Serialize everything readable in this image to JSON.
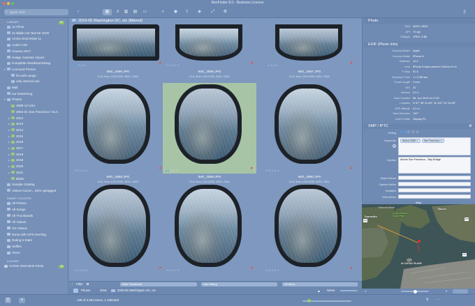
{
  "window": {
    "title": "NeoFinder 8.0 - Business License"
  },
  "toolbar": {
    "search_placeholder": "Quick Find"
  },
  "sidebar": {
    "library_header": "LIBRARY",
    "library_badge": "87",
    "library_items": [
      {
        "label": "12 Filme",
        "icon": "folder",
        "indent": 0,
        "tri": ""
      },
      {
        "label": "21 Bilder mit Text für OCR",
        "icon": "folder",
        "indent": 0,
        "tri": ""
      },
      {
        "label": "Archiv DVD-ROM 11",
        "icon": "folder",
        "indent": 0,
        "tri": ""
      },
      {
        "label": "Audio-CDs",
        "icon": "folder",
        "indent": 0,
        "tri": ""
      },
      {
        "label": "Cinema 2017",
        "icon": "folder",
        "indent": 0,
        "tri": ""
      },
      {
        "label": "Hedge Canister Import",
        "icon": "folder",
        "indent": 0,
        "tri": ""
      },
      {
        "label": "Komplette Musiksammlung",
        "icon": "folder",
        "indent": 0,
        "tri": ""
      },
      {
        "label": "Licensed Photos",
        "icon": "folder",
        "indent": 0,
        "tri": "▾"
      },
      {
        "label": "for web usage",
        "icon": "folder",
        "indent": 1,
        "tri": ""
      },
      {
        "label": "only internal use",
        "icon": "folder",
        "indent": 1,
        "tri": ""
      },
      {
        "label": "Mail",
        "icon": "folder",
        "indent": 0,
        "tri": ""
      },
      {
        "label": "nur bewertung",
        "icon": "folder",
        "indent": 0,
        "tri": ""
      },
      {
        "label": "Photos",
        "icon": "folder",
        "indent": 0,
        "tri": "▾"
      },
      {
        "label": "1998-12 USA",
        "icon": "green",
        "indent": 1,
        "tri": ""
      },
      {
        "label": "2002-01 San Francisco / SLC",
        "icon": "green",
        "indent": 1,
        "tri": ""
      },
      {
        "label": "2012",
        "icon": "green",
        "indent": 1,
        "tri": "▸"
      },
      {
        "label": "2013",
        "icon": "green",
        "indent": 1,
        "tri": "▸"
      },
      {
        "label": "2014",
        "icon": "green",
        "indent": 1,
        "tri": "▸"
      },
      {
        "label": "2015",
        "icon": "green",
        "indent": 1,
        "tri": "▸"
      },
      {
        "label": "2016",
        "icon": "green",
        "indent": 1,
        "tri": "▸"
      },
      {
        "label": "2017",
        "icon": "green",
        "indent": 1,
        "tri": "▸"
      },
      {
        "label": "2018",
        "icon": "green",
        "indent": 1,
        "tri": "▸"
      },
      {
        "label": "2019",
        "icon": "green",
        "indent": 1,
        "tri": "▸"
      },
      {
        "label": "2020",
        "icon": "green",
        "indent": 1,
        "tri": "▸"
      },
      {
        "label": "2021",
        "icon": "green",
        "indent": 1,
        "tri": "▸"
      },
      {
        "label": "Bilder",
        "icon": "green",
        "indent": 1,
        "tri": ""
      },
      {
        "label": "Sample Catalog",
        "icon": "folder",
        "indent": 0,
        "tri": ""
      },
      {
        "label": "Videos Canon...InDV getagged",
        "icon": "folder",
        "indent": 0,
        "tri": ""
      }
    ],
    "smart_header": "SMART FOLDERS",
    "smart_items": [
      "All Photos",
      "All Songs",
      "All Thumbnails",
      "All Videos",
      "HD Videos",
      "Items with GPS GeoTag",
      "Rating 5 Stars",
      "Selfies",
      "Years"
    ],
    "album_header": "ALBUMS",
    "album_item": "Arches 2018 Best Shots",
    "album_badge": "18"
  },
  "breadcrumb": {
    "title": "2019-06 Washington DC, etc  (filtered)"
  },
  "grid": {
    "items": [
      {
        "name": "IMG_2496.JPG",
        "meta": "f/1.8, 3mm, 1/16 ISO20, 4032 × 3024",
        "selected": false,
        "rating": 2,
        "pin": true
      },
      {
        "name": "IMG_2586.JPG",
        "meta": "f/1.8, 3mm, 1/16 ISO20, 4032 × 3024",
        "selected": false,
        "rating": 0,
        "pin": true
      },
      {
        "name": "IMG_2587.JPG",
        "meta": "f/1.8, 3mm, 1/16 ISO20, 4032 × 3024",
        "selected": false,
        "rating": 1,
        "pin": true
      },
      {
        "name": "IMG_2588.JPG",
        "meta": "f/1.8, 3mm, 1/16 ISO20, 4032 × 3024",
        "selected": false,
        "rating": 0,
        "pin": true
      },
      {
        "name": "IMG_2589.JPG",
        "meta": "f/1.8, 3mm, 1/16 ISO20, 4032 × 3024",
        "selected": true,
        "rating": 2,
        "pin": true
      },
      {
        "name": "IMG_2590.JPG",
        "meta": "f/1.8, 3mm, 1/16 ISO20, 4032 × 3024",
        "selected": false,
        "rating": 0,
        "pin": true
      },
      {
        "name": "IMG_2591.JPG",
        "meta": "f/1.8, 3mm, 1/16 ISO20, 4032 × 3024",
        "selected": false,
        "rating": 0,
        "pin": true
      },
      {
        "name": "IMG_2592.JPG",
        "meta": "f/1.8, 3mm, 1/16 ISO20, 4032 × 3024",
        "selected": false,
        "rating": 0,
        "pin": true
      },
      {
        "name": "IMG_2593.JPG",
        "meta": "f/1.8, 3mm, 1/16 ISO20, 4032 × 3024",
        "selected": false,
        "rating": 0,
        "pin": true
      }
    ]
  },
  "filter": {
    "label": "Filter",
    "opt1": "With Thumbnail",
    "opt2": "Has Rating",
    "opt3": "All Items"
  },
  "pathbar": {
    "segment1": "Photos",
    "segment2": "2019",
    "segment3": "2019-06 Washington DC, etc",
    "sort_label": "Name"
  },
  "inspector": {
    "photo_header": "Photo",
    "photo_rows": [
      {
        "k": "Size",
        "v": "4032 x 3024"
      },
      {
        "k": "DPI",
        "v": "72 dpi"
      },
      {
        "k": "Filetype",
        "v": "JPEG, 8 Bit"
      }
    ],
    "exif_header": "EXIF (Photo Info)",
    "exif_rows": [
      {
        "k": "Camera Maker",
        "v": "Apple"
      },
      {
        "k": "Camera Model",
        "v": "iPhone 8"
      },
      {
        "k": "Software",
        "v": "12.2"
      },
      {
        "k": "Lens",
        "v": "iPhone 8 back camera 3.99mm f/1.8"
      },
      {
        "k": "F-Stop",
        "v": "f/1.8"
      },
      {
        "k": "Exposure Time",
        "v": "1 / 1798 sec."
      },
      {
        "k": "Focal Length",
        "v": "3 mm"
      },
      {
        "k": "ISO",
        "v": "20"
      },
      {
        "k": "Version",
        "v": "2.2.1"
      },
      {
        "k": "Date Created",
        "v": "06. Jun 2019 at 17:53"
      },
      {
        "k": "Location",
        "v": "N 37° 48' 41.65\", W 122° 24' 24.00\""
      },
      {
        "k": "GPS Altitude",
        "v": "0.2 m"
      },
      {
        "k": "View Direction",
        "v": "120°"
      },
      {
        "k": "Color Profile",
        "v": "Display P3"
      }
    ],
    "xmp_header": "XMP / IPTC",
    "rating_label": "Rating",
    "keywords_label": "Keywords",
    "keywords": [
      "Airbus A380",
      "San Francisco"
    ],
    "caption_label": "Caption",
    "caption_value": "Above San Francisco - Bay Bridge",
    "object_name_label": "Object Name",
    "caption_writer_label": "Caption Writer",
    "headline_label": "Headline",
    "instructions_label": "Instructions"
  },
  "map": {
    "header": "Map",
    "labels": [
      "Sausalito",
      "Raccoon Strait",
      "Angel Island State Park",
      "Tiburon",
      "ALCATRAZ ISLAND"
    ],
    "route_badges": [
      "101",
      "580",
      "80"
    ]
  },
  "status": {
    "text": "128 of 2.554 items, 1 selected"
  },
  "colors": {
    "accent": "#4aa6ff",
    "selection": "#a7c4a7",
    "pin": "#e04848"
  }
}
